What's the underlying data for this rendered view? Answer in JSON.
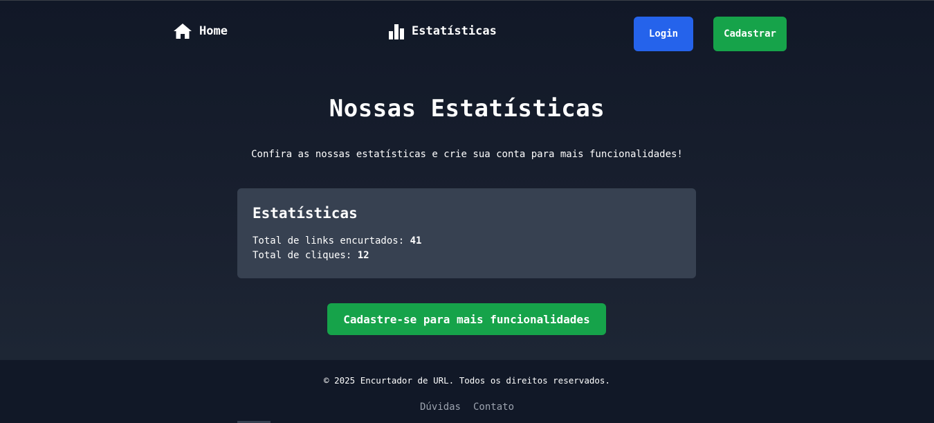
{
  "nav": {
    "home_label": "Home",
    "home_icon": "home-icon",
    "stats_label": "Estatísticas",
    "stats_icon": "bar-chart-icon",
    "login_label": "Login",
    "register_label": "Cadastrar"
  },
  "main": {
    "title": "Nossas Estatísticas",
    "subtitle": "Confira as nossas estatísticas e crie sua conta para mais funcionalidades!",
    "card": {
      "title": "Estatísticas",
      "links_label": "Total de links encurtados: ",
      "links_value": "41",
      "clicks_label": "Total de cliques: ",
      "clicks_value": "12"
    },
    "cta_label": "Cadastre-se para mais funcionalidades"
  },
  "footer": {
    "copyright": "© 2025 Encurtador de URL. Todos os direitos reservados.",
    "links": [
      "Dúvidas",
      "Contato"
    ]
  },
  "colors": {
    "background": "#111827",
    "card": "#374151",
    "primary_blue": "#2563eb",
    "primary_green": "#16a34a",
    "muted_text": "#9ca3af"
  }
}
